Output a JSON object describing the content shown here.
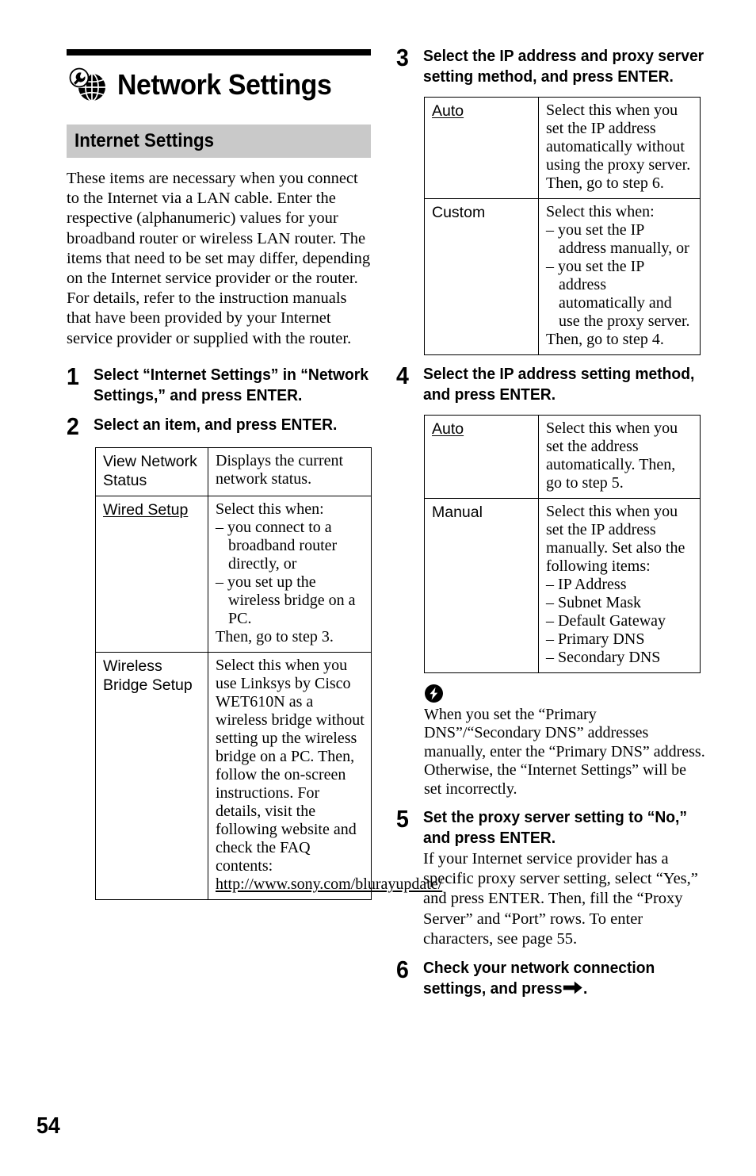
{
  "page": {
    "folio": "54"
  },
  "header": {
    "icon": "wrench-globe-icon",
    "title": "Network Settings"
  },
  "section": {
    "title": "Internet Settings",
    "band_color": "#c9c9c9",
    "intro": "These items are necessary when you connect to the Internet via a LAN cable. Enter the respective (alphanumeric) values for your broadband router or wireless LAN router. The items that need to be set may differ, depending on the Internet service provider or the router. For details, refer to the instruction manuals that have been provided by your Internet service provider or supplied with the router."
  },
  "steps": [
    {
      "number": "1",
      "heading": "Select “Internet Settings” in “Network Settings,” and press ENTER."
    },
    {
      "number": "2",
      "heading": "Select an item, and press ENTER."
    },
    {
      "number": "3",
      "heading": "Select the IP address and proxy server setting method, and press ENTER."
    },
    {
      "number": "4",
      "heading": "Select the IP address setting method, and press ENTER."
    },
    {
      "number": "5",
      "heading": "Set the proxy server setting to “No,” and press ENTER.",
      "body": "If your Internet service provider has a specific proxy server setting, select “Yes,” and press ENTER. Then, fill the “Proxy Server” and “Port” rows. To enter characters, see page 55."
    },
    {
      "number": "6",
      "heading_before_arrow": "Check your network connection settings, and press",
      "arrow_icon": "right-arrow-icon",
      "heading_after_arrow": "."
    }
  ],
  "table_step2": {
    "rows": [
      {
        "key": "View Network Status",
        "key_underlined": false,
        "lines": [
          {
            "text": "Displays the current network status.",
            "style": "plain"
          }
        ]
      },
      {
        "key": "Wired Setup",
        "key_underlined": true,
        "lines": [
          {
            "text": "Select this when:",
            "style": "plain"
          },
          {
            "text": "– you connect to a broadband router directly, or",
            "style": "dash"
          },
          {
            "text": "– you set up the wireless bridge on a PC.",
            "style": "dash"
          },
          {
            "text": "Then, go to step 3.",
            "style": "plain"
          }
        ]
      },
      {
        "key": "Wireless Bridge Setup",
        "key_underlined": false,
        "lines": [
          {
            "text": "Select this when you use Linksys by Cisco WET610N as a wireless bridge without setting up the wireless bridge on a PC. Then, follow the on-screen instructions. For details, visit the following website and check the FAQ contents:",
            "style": "plain"
          },
          {
            "text": "http://www.sony.com/blurayupdate/",
            "style": "link"
          }
        ]
      }
    ]
  },
  "table_step3": {
    "rows": [
      {
        "key": "Auto",
        "key_underlined": true,
        "lines": [
          {
            "text": "Select this when you set the IP address automatically without using the proxy server. Then, go to step 6.",
            "style": "plain"
          }
        ]
      },
      {
        "key": "Custom",
        "key_underlined": false,
        "lines": [
          {
            "text": "Select this when:",
            "style": "plain"
          },
          {
            "text": "– you set the IP address manually, or",
            "style": "dash"
          },
          {
            "text": "– you set the IP address automatically and use the proxy server.",
            "style": "dash"
          },
          {
            "text": "Then, go to step 4.",
            "style": "plain"
          }
        ]
      }
    ]
  },
  "table_step4": {
    "rows": [
      {
        "key": "Auto",
        "key_underlined": true,
        "lines": [
          {
            "text": "Select this when you set the address automatically. Then, go to step 5.",
            "style": "plain"
          }
        ]
      },
      {
        "key": "Manual",
        "key_underlined": false,
        "lines": [
          {
            "text": "Select this when you set the IP address manually. Set also the following items:",
            "style": "plain"
          },
          {
            "text": "– IP Address",
            "style": "dash"
          },
          {
            "text": "– Subnet Mask",
            "style": "dash"
          },
          {
            "text": "– Default Gateway",
            "style": "dash"
          },
          {
            "text": "– Primary DNS",
            "style": "dash"
          },
          {
            "text": "– Secondary DNS",
            "style": "dash"
          }
        ]
      }
    ]
  },
  "note": {
    "icon": "note-bolt-icon",
    "text": "When you set the “Primary DNS”/“Secondary DNS” addresses manually, enter the “Primary DNS” address. Otherwise, the “Internet Settings” will be set incorrectly."
  }
}
